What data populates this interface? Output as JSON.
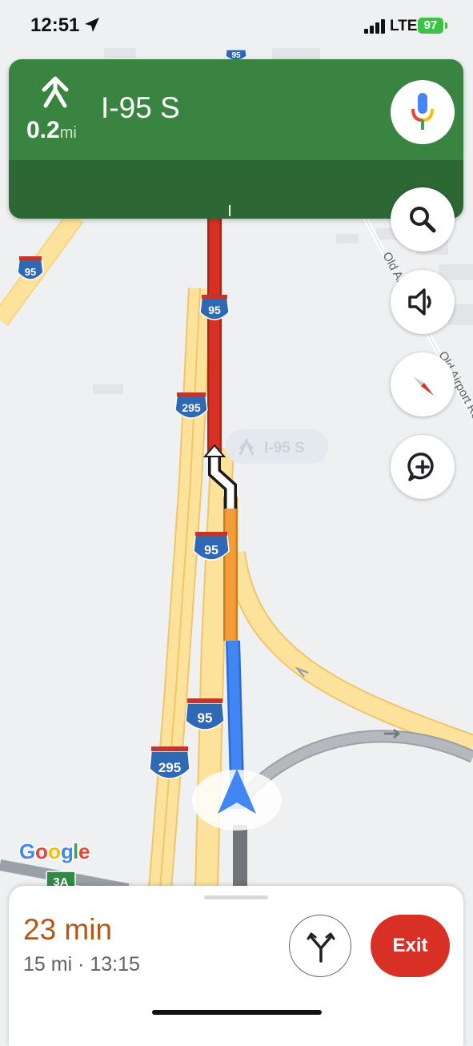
{
  "status_bar": {
    "time": "12:51",
    "network": "LTE",
    "battery": "97"
  },
  "navigation": {
    "distance_value": "0.2",
    "distance_unit": "mi",
    "road": "I-95 S",
    "map_callout": "I-95 S"
  },
  "map": {
    "streets": [
      "Old Airport Rd",
      "Old Airport Rd"
    ],
    "shields": [
      "95",
      "95",
      "295",
      "95",
      "95",
      "295",
      "3A",
      "95"
    ]
  },
  "trip": {
    "duration": "23 min",
    "details": "15 mi · 13:15"
  },
  "buttons": {
    "exit": "Exit"
  },
  "branding": {
    "logo": "Google"
  },
  "icons": [
    "navigation-arrow-icon",
    "merge-arrow-icon",
    "microphone-icon",
    "lane-turn-right-icon",
    "search-icon",
    "volume-icon",
    "compass-icon",
    "add-comment-icon",
    "alternate-routes-icon",
    "current-location-arrow-icon"
  ],
  "colors": {
    "nav_green": "#3a8441",
    "nav_green_dark": "#2d6734",
    "traffic_red": "#d93025",
    "traffic_orange": "#f29d38",
    "route_blue": "#4285f4",
    "eta_orange": "#b3581b",
    "exit_red": "#d93025"
  }
}
